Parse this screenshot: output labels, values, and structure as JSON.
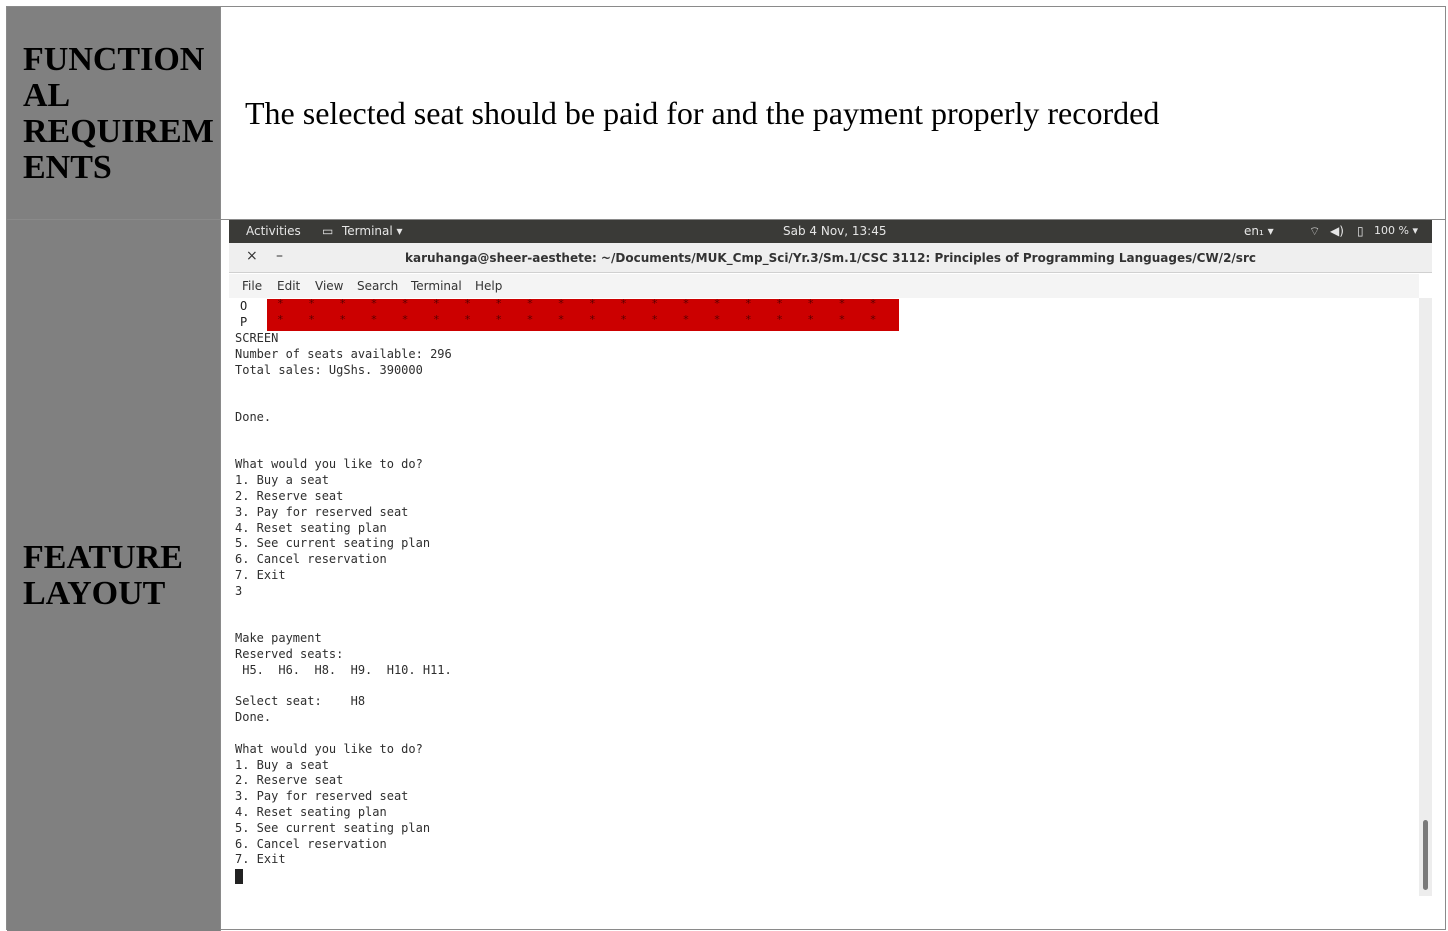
{
  "requirements": {
    "label": "FUNCTION\nAL\nREQUIREM\nENTS",
    "text": "The selected seat should be paid for and the payment properly recorded"
  },
  "feature": {
    "label": "FEATURE\nLAYOUT"
  },
  "topbar": {
    "activities": "Activities",
    "app_menu": "Terminal ▾",
    "clock": "Sab  4 Nov, 13:45",
    "lang": "en₁ ▾",
    "battery": "100 % ▾"
  },
  "window": {
    "title": "karuhanga@sheer-aesthete: ~/Documents/MUK_Cmp_Sci/Yr.3/Sm.1/CSC 3112: Principles of Programming Languages/CW/2/src",
    "close": "×",
    "minimize": "–"
  },
  "menu": [
    "File",
    "Edit",
    "View",
    "Search",
    "Terminal",
    "Help"
  ],
  "seat_rows": [
    {
      "label": "O",
      "seats": "* * * * * * * * * * * * * * * * * * * *"
    },
    {
      "label": "P",
      "seats": "* * * * * * * * * * * * * * * * * * * *"
    }
  ],
  "terminal_lines": [
    "SCREEN",
    "Number of seats available: 296",
    "Total sales: UgShs. 390000",
    "",
    "",
    "Done.",
    "",
    "",
    "What would you like to do?",
    "1. Buy a seat",
    "2. Reserve seat",
    "3. Pay for reserved seat",
    "4. Reset seating plan",
    "5. See current seating plan",
    "6. Cancel reservation",
    "7. Exit",
    "3",
    "",
    "",
    "Make payment",
    "Reserved seats:",
    " H5.  H6.  H8.  H9.  H10. H11.",
    "",
    "Select seat:    H8",
    "Done.",
    "",
    "What would you like to do?",
    "1. Buy a seat",
    "2. Reserve seat",
    "3. Pay for reserved seat",
    "4. Reset seating plan",
    "5. See current seating plan",
    "6. Cancel reservation",
    "7. Exit"
  ]
}
